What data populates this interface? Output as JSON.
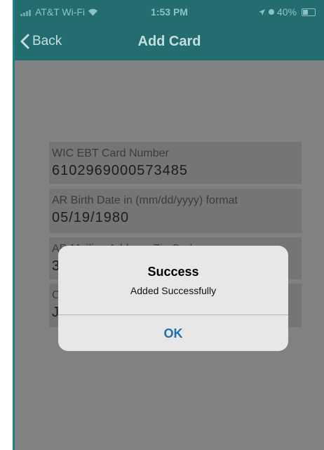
{
  "status_bar": {
    "carrier": "AT&T Wi-Fi",
    "time": "1:53 PM",
    "battery": "40%"
  },
  "nav": {
    "back_label": "Back",
    "title": "Add Card"
  },
  "form": {
    "fields": [
      {
        "label": "WIC EBT Card Number",
        "value": "6102969000573485"
      },
      {
        "label": "AR Birth Date in (mm/dd/yyyy) format",
        "value": "05/19/1980"
      },
      {
        "label": "AR Mailing Address Zip Code",
        "value": "3"
      },
      {
        "label": "C",
        "value": "Je"
      }
    ]
  },
  "alert": {
    "title": "Success",
    "message": "Added Successfully",
    "button": "OK"
  },
  "colors": {
    "brand_teal": "#1a818a",
    "alert_button": "#1f6fb5"
  }
}
